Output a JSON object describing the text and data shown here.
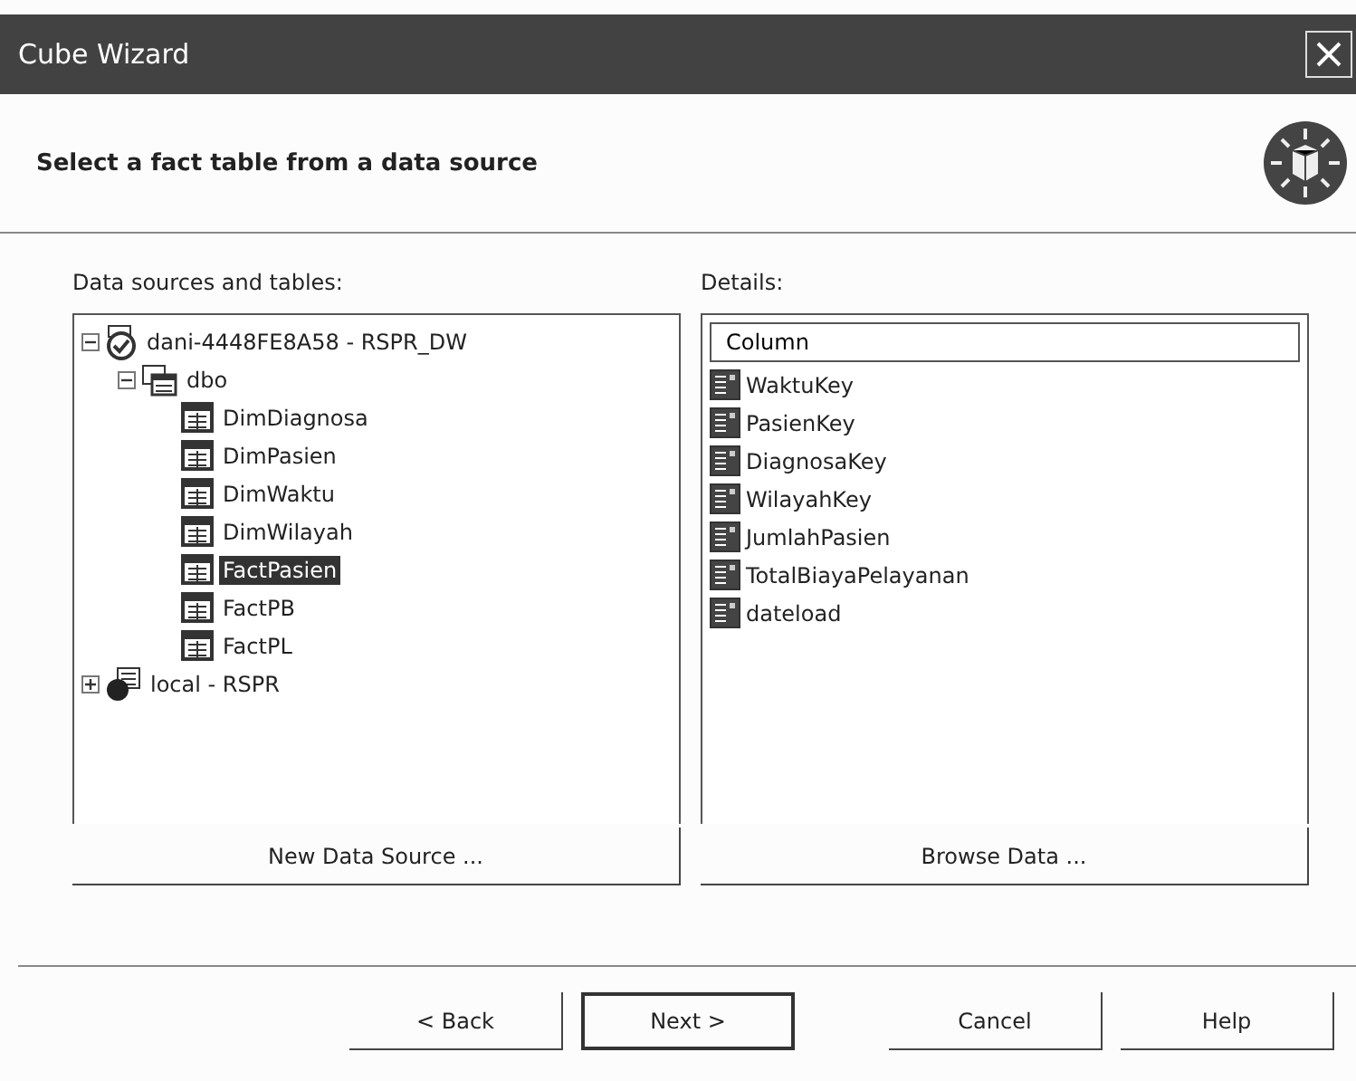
{
  "window": {
    "title": "Cube Wizard"
  },
  "header": {
    "title": "Select a fact table from a data source"
  },
  "tree": {
    "label": "Data sources and tables:",
    "items": [
      {
        "label": "dani-4448FE8A58 - RSPR_DW",
        "kind": "database",
        "expanded": true,
        "selected": false,
        "children": [
          {
            "label": "dbo",
            "kind": "schema",
            "expanded": true,
            "selected": false,
            "children": [
              {
                "label": "DimDiagnosa",
                "kind": "table",
                "selected": false
              },
              {
                "label": "DimPasien",
                "kind": "table",
                "selected": false
              },
              {
                "label": "DimWaktu",
                "kind": "table",
                "selected": false
              },
              {
                "label": "DimWilayah",
                "kind": "table",
                "selected": false
              },
              {
                "label": "FactPasien",
                "kind": "table",
                "selected": true
              },
              {
                "label": "FactPB",
                "kind": "table",
                "selected": false
              },
              {
                "label": "FactPL",
                "kind": "table",
                "selected": false
              }
            ]
          }
        ]
      },
      {
        "label": "local - RSPR",
        "kind": "datasource",
        "expanded": false,
        "selected": false
      }
    ]
  },
  "details": {
    "label": "Details:",
    "column_header": "Column",
    "rows": [
      "WaktuKey",
      "PasienKey",
      "DiagnosaKey",
      "WilayahKey",
      "JumlahPasien",
      "TotalBiayaPelayanan",
      "dateload"
    ]
  },
  "panel_buttons": [
    "New Data Source ...",
    "Browse Data ..."
  ],
  "buttons": [
    {
      "label": "< Back",
      "default": false
    },
    {
      "label": "Next >",
      "default": true
    },
    {
      "label": "Cancel",
      "default": false
    },
    {
      "label": "Help",
      "default": false
    }
  ]
}
